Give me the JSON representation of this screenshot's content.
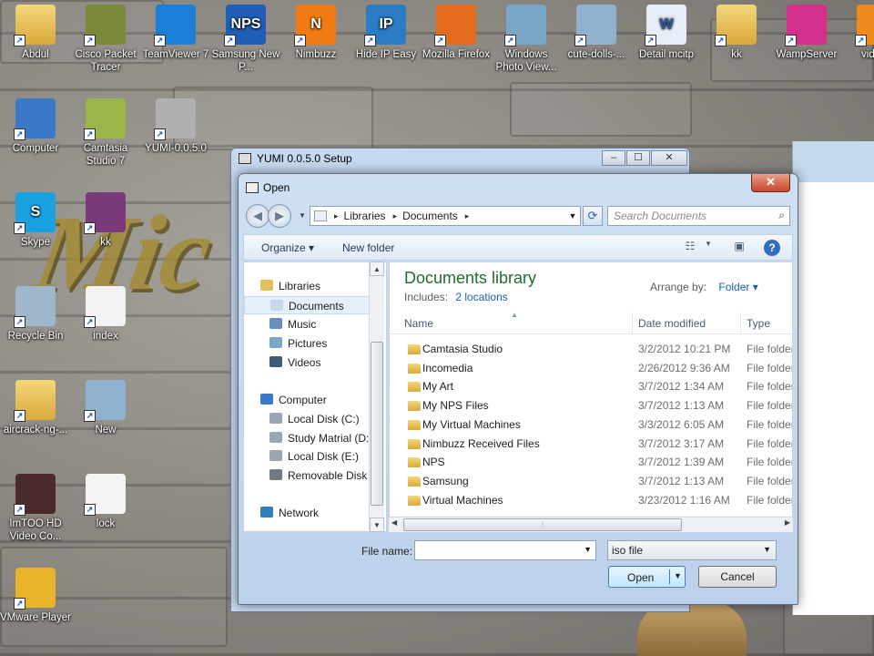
{
  "desktop": {
    "icons": [
      {
        "label": "Abdul",
        "icon": "user-folder-icon"
      },
      {
        "label": "Cisco Packet Tracer",
        "icon": "cisco-packet-tracer-icon"
      },
      {
        "label": "TeamViewer 7",
        "icon": "teamviewer-icon"
      },
      {
        "label": "Samsung New P...",
        "icon": "samsung-nps-icon",
        "glyph": "NPS"
      },
      {
        "label": "Nimbuzz",
        "icon": "nimbuzz-icon",
        "glyph": "N"
      },
      {
        "label": "Hide IP Easy",
        "icon": "hide-ip-icon",
        "glyph": "IP"
      },
      {
        "label": "Mozilla Firefox",
        "icon": "firefox-icon"
      },
      {
        "label": "Windows Photo View...",
        "icon": "photo-viewer-icon"
      },
      {
        "label": "cute-dolls-...",
        "icon": "image-file-icon"
      },
      {
        "label": "Detail mcitp",
        "icon": "word-document-icon",
        "glyph": "W"
      },
      {
        "label": "kk",
        "icon": "folder-icon"
      },
      {
        "label": "WampServer",
        "icon": "wampserver-icon"
      },
      {
        "label": "videop",
        "icon": "vlc-icon"
      },
      {
        "label": "Computer",
        "icon": "computer-icon"
      },
      {
        "label": "Camtasia Studio 7",
        "icon": "camtasia-icon"
      },
      {
        "label": "YUMI-0.0.5.0",
        "icon": "yumi-icon"
      },
      {
        "label": "Skype",
        "icon": "skype-icon",
        "glyph": "S"
      },
      {
        "label": "kk",
        "icon": "winrar-icon"
      },
      {
        "label": "Recycle Bin",
        "icon": "recycle-bin-icon"
      },
      {
        "label": "index",
        "icon": "firefox-html-icon"
      },
      {
        "label": "aircrack-ng-...",
        "icon": "folder-icon"
      },
      {
        "label": "New",
        "icon": "image-file-icon"
      },
      {
        "label": "ImTOO HD Video Co...",
        "icon": "imtoo-icon"
      },
      {
        "label": "lock",
        "icon": "text-file-icon"
      },
      {
        "label": "VMware Player",
        "icon": "vmware-icon"
      }
    ],
    "wallpaper_text": "Mic"
  },
  "back_window": {
    "title": "YUMI 0.0.5.0 Setup",
    "min": "–",
    "max": "☐",
    "close": "✕"
  },
  "dialog": {
    "title": "Open",
    "close": "✕",
    "address": {
      "segments": [
        "Libraries",
        "Documents"
      ],
      "sep": "▸"
    },
    "search_placeholder": "Search Documents",
    "toolbar": {
      "organize": "Organize ▾",
      "new_folder": "New folder",
      "help": "?"
    },
    "nav": {
      "items": [
        {
          "label": "Libraries",
          "icon": "libraries-icon"
        },
        {
          "label": "Documents",
          "icon": "documents-icon",
          "selected": true
        },
        {
          "label": "Music",
          "icon": "music-icon"
        },
        {
          "label": "Pictures",
          "icon": "pictures-icon"
        },
        {
          "label": "Videos",
          "icon": "videos-icon"
        },
        {
          "label": "Computer",
          "icon": "computer-icon"
        },
        {
          "label": "Local Disk (C:)",
          "icon": "drive-icon"
        },
        {
          "label": "Study Matrial (D:",
          "icon": "drive-icon"
        },
        {
          "label": "Local Disk (E:)",
          "icon": "drive-icon"
        },
        {
          "label": "Removable Disk (",
          "icon": "removable-drive-icon"
        },
        {
          "label": "Network",
          "icon": "network-icon"
        }
      ]
    },
    "library": {
      "title": "Documents library",
      "includes_label": "Includes:",
      "includes_link": "2 locations",
      "arrange_label": "Arrange by:",
      "arrange_value": "Folder ▾"
    },
    "columns": {
      "name": "Name",
      "date": "Date modified",
      "type": "Type"
    },
    "rows": [
      {
        "name": "Camtasia Studio",
        "date": "3/2/2012 10:21 PM",
        "type": "File folder"
      },
      {
        "name": "Incomedia",
        "date": "2/26/2012 9:36 AM",
        "type": "File folder"
      },
      {
        "name": "My Art",
        "date": "3/7/2012 1:34 AM",
        "type": "File folder"
      },
      {
        "name": "My NPS Files",
        "date": "3/7/2012 1:13 AM",
        "type": "File folder"
      },
      {
        "name": "My Virtual Machines",
        "date": "3/3/2012 6:05 AM",
        "type": "File folder"
      },
      {
        "name": "Nimbuzz Received Files",
        "date": "3/7/2012 3:17 AM",
        "type": "File folder"
      },
      {
        "name": "NPS",
        "date": "3/7/2012 1:39 AM",
        "type": "File folder"
      },
      {
        "name": "Samsung",
        "date": "3/7/2012 1:13 AM",
        "type": "File folder"
      },
      {
        "name": "Virtual Machines",
        "date": "3/23/2012 1:16 AM",
        "type": "File folder"
      }
    ],
    "file_name_label": "File name:",
    "file_name_value": "",
    "file_type": "iso file",
    "open_label": "Open",
    "cancel_label": "Cancel"
  },
  "colors": {
    "library_title": "#1e6e2c",
    "link": "#1a5fb4",
    "titlebar": "#c5d8ee",
    "close_button": "#c9462c"
  }
}
